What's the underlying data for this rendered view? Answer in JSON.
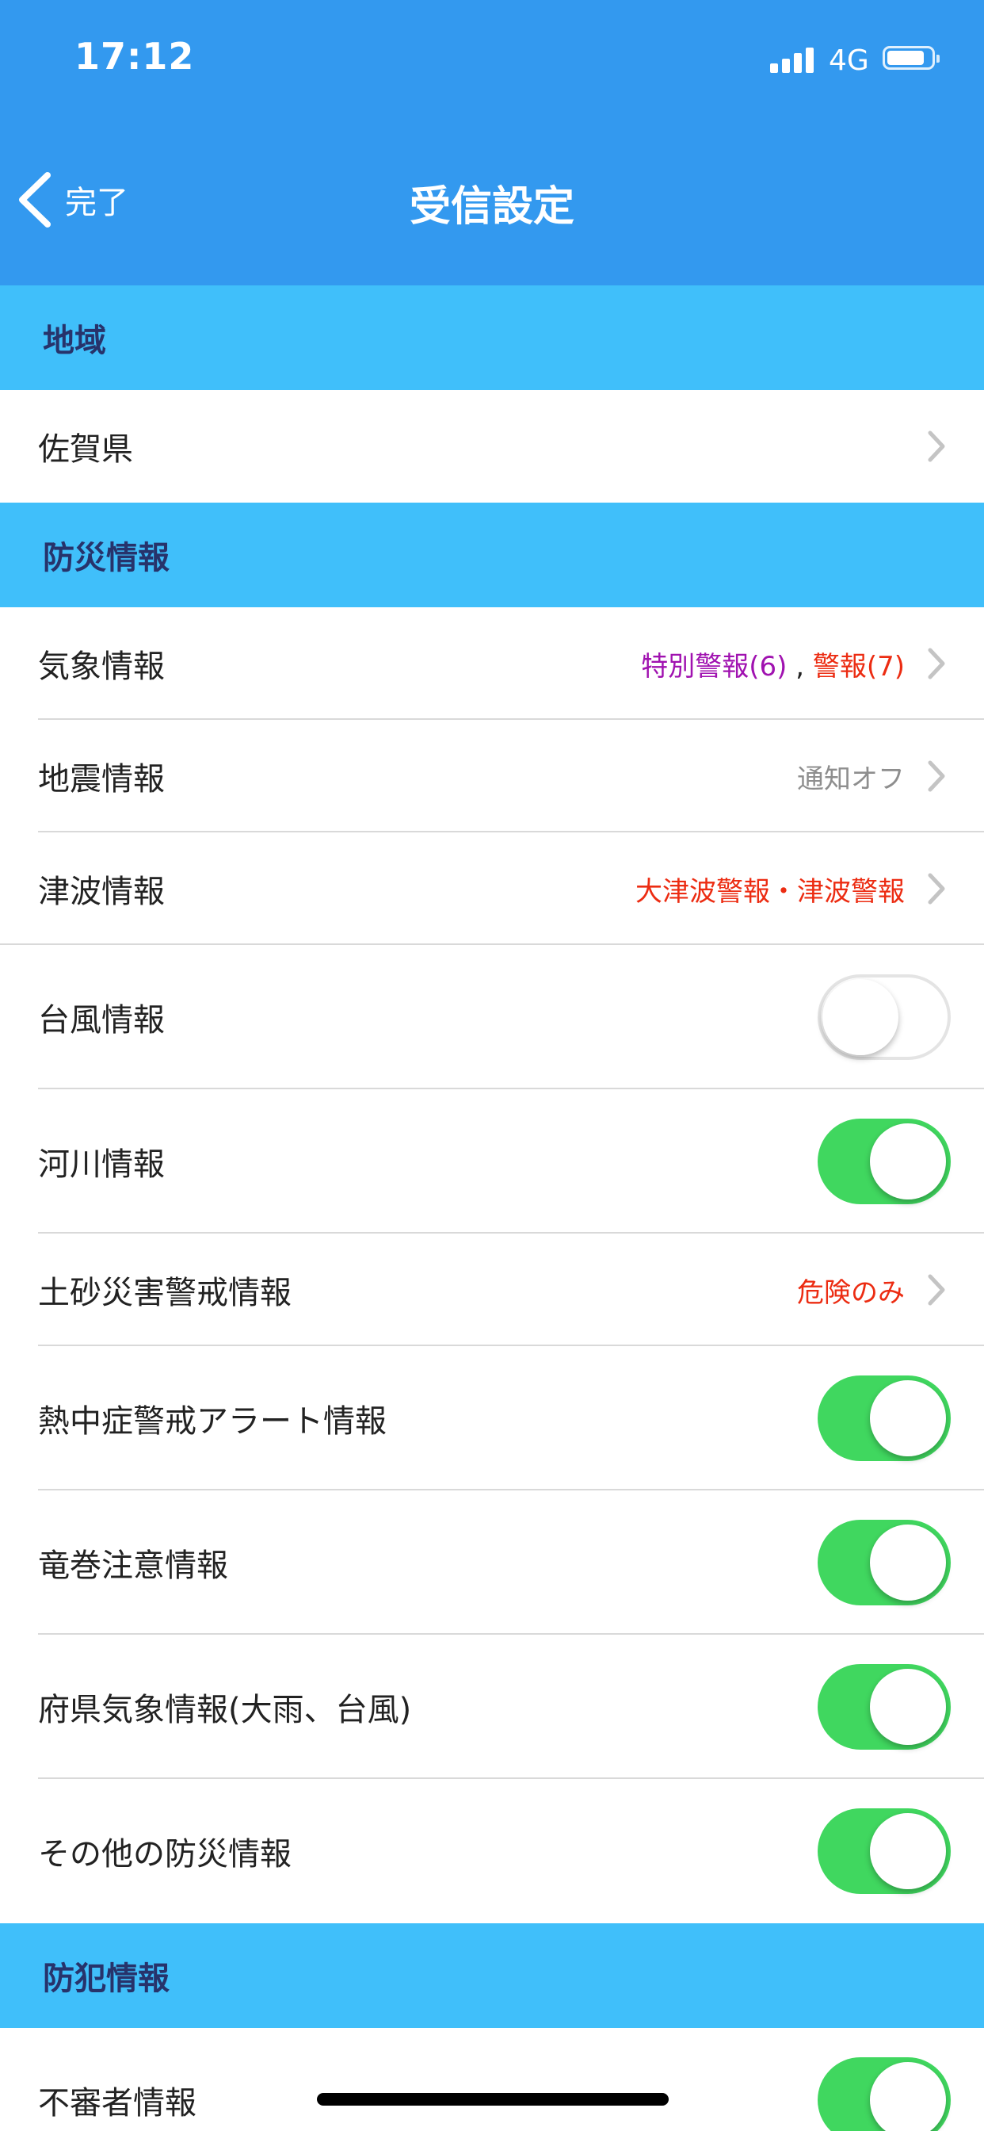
{
  "status_bar": {
    "time": "17:12",
    "network": "4G"
  },
  "nav": {
    "back_label": "完了",
    "title": "受信設定"
  },
  "sections": {
    "region": {
      "header": "地域",
      "item": {
        "label": "佐賀県"
      }
    },
    "disaster": {
      "header": "防災情報",
      "weather": {
        "label": "気象情報",
        "value_special": "特別警報(6)",
        "value_sep": " , ",
        "value_warning": "警報(7)"
      },
      "earthquake": {
        "label": "地震情報",
        "value": "通知オフ"
      },
      "tsunami": {
        "label": "津波情報",
        "value": "大津波警報・津波警報"
      },
      "typhoon": {
        "label": "台風情報",
        "toggle": "off"
      },
      "river": {
        "label": "河川情報",
        "toggle": "on"
      },
      "landslide": {
        "label": "土砂災害警戒情報",
        "value": "危険のみ"
      },
      "heatstroke": {
        "label": "熱中症警戒アラート情報",
        "toggle": "on"
      },
      "tornado": {
        "label": "竜巻注意情報",
        "toggle": "on"
      },
      "prefecture_weather": {
        "label": "府県気象情報(大雨、台風)",
        "toggle": "on"
      },
      "other": {
        "label": "その他の防災情報",
        "toggle": "on"
      }
    },
    "crime": {
      "header": "防犯情報",
      "suspicious": {
        "label": "不審者情報",
        "toggle": "on"
      }
    }
  },
  "colors": {
    "nav_blue": "#3399ef",
    "section_blue": "#40bffa",
    "section_text": "#27336b",
    "toggle_on": "#40d75f",
    "special_warning": "#a012b0",
    "warning_red": "#ec2c12",
    "muted_gray": "#8e8e8e"
  },
  "icons": {
    "back": "chevron-left-icon",
    "disclosure": "chevron-right-icon",
    "signal": "signal-bars-icon",
    "battery": "battery-icon"
  }
}
